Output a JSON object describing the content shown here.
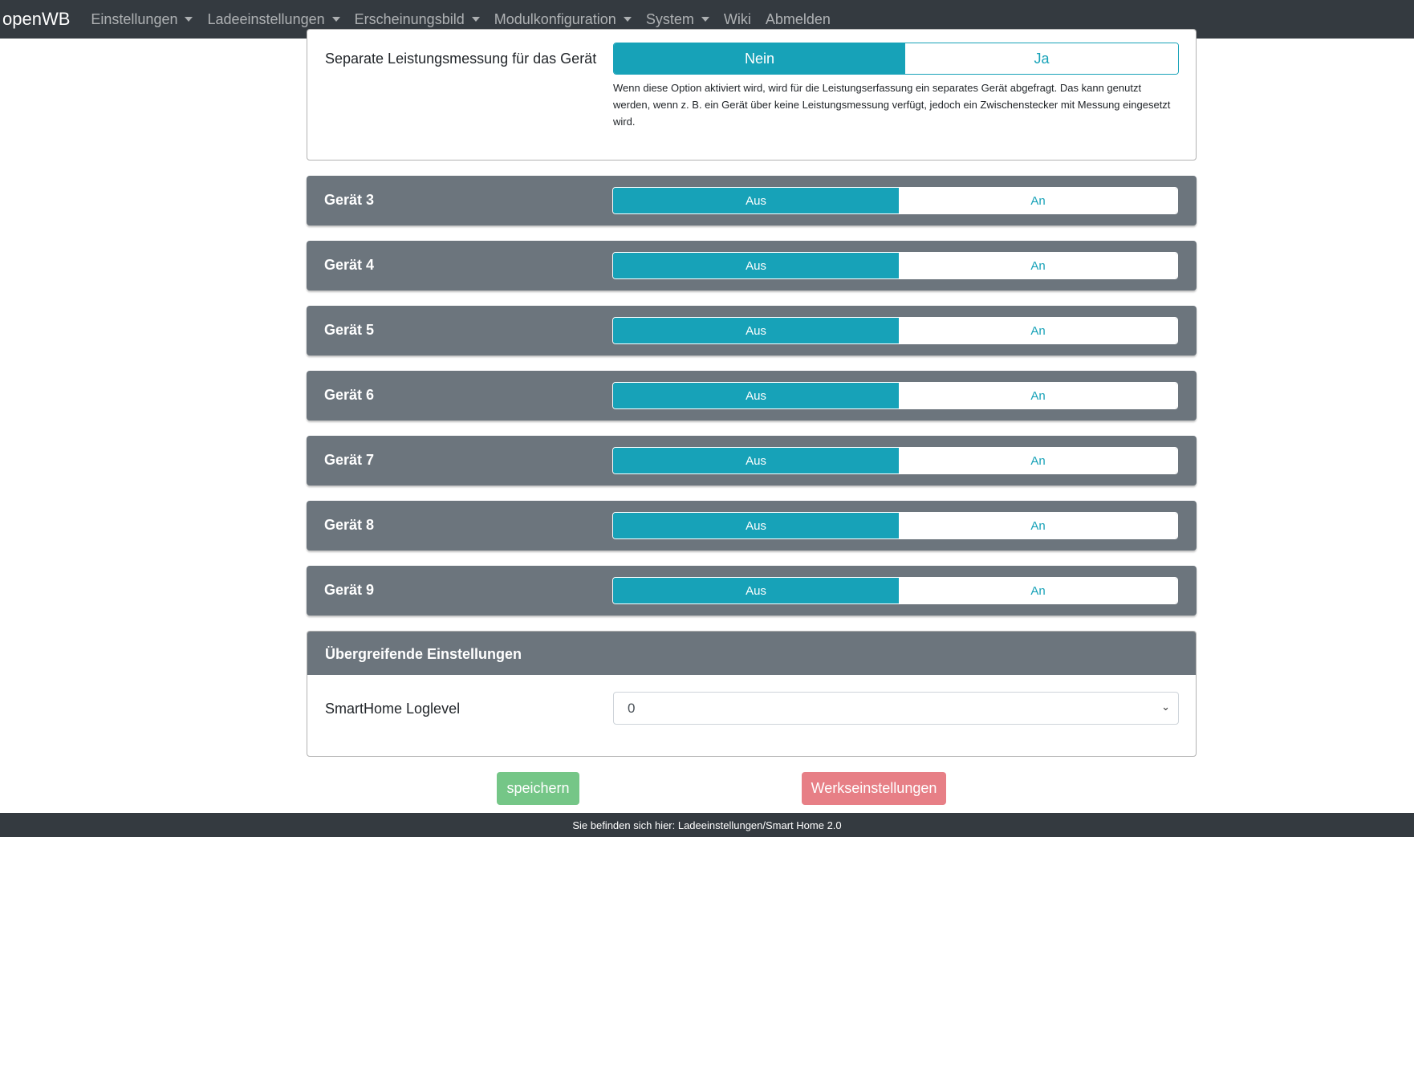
{
  "navbar": {
    "brand": "openWB",
    "items": [
      {
        "label": "Einstellungen",
        "dropdown": true
      },
      {
        "label": "Ladeeinstellungen",
        "dropdown": true
      },
      {
        "label": "Erscheinungsbild",
        "dropdown": true
      },
      {
        "label": "Modulkonfiguration",
        "dropdown": true
      },
      {
        "label": "System",
        "dropdown": true
      },
      {
        "label": "Wiki",
        "dropdown": false
      },
      {
        "label": "Abmelden",
        "dropdown": false
      }
    ]
  },
  "separate": {
    "label": "Separate Leistungsmessung für das Gerät",
    "options": [
      "Nein",
      "Ja"
    ],
    "selected": "Nein",
    "help": "Wenn diese Option aktiviert wird, wird für die Leistungserfassung ein separates Gerät abgefragt. Das kann genutzt werden, wenn z. B. ein Gerät über keine Leistungsmessung verfügt, jedoch ein Zwischenstecker mit Messung eingesetzt wird."
  },
  "devices": [
    {
      "name": "Gerät 3",
      "off": "Aus",
      "on": "An",
      "selected": "Aus"
    },
    {
      "name": "Gerät 4",
      "off": "Aus",
      "on": "An",
      "selected": "Aus"
    },
    {
      "name": "Gerät 5",
      "off": "Aus",
      "on": "An",
      "selected": "Aus"
    },
    {
      "name": "Gerät 6",
      "off": "Aus",
      "on": "An",
      "selected": "Aus"
    },
    {
      "name": "Gerät 7",
      "off": "Aus",
      "on": "An",
      "selected": "Aus"
    },
    {
      "name": "Gerät 8",
      "off": "Aus",
      "on": "An",
      "selected": "Aus"
    },
    {
      "name": "Gerät 9",
      "off": "Aus",
      "on": "An",
      "selected": "Aus"
    }
  ],
  "global": {
    "title": "Übergreifende Einstellungen",
    "loglevel_label": "SmartHome Loglevel",
    "loglevel_value": "0"
  },
  "buttons": {
    "save": "speichern",
    "reset": "Werkseinstellungen"
  },
  "footer": "Sie befinden sich hier: Ladeeinstellungen/Smart Home 2.0",
  "colors": {
    "accent": "#17a2b8",
    "navbar": "#343a40",
    "card_header": "#6c757d",
    "save": "#75c687",
    "reset": "#e77f86"
  }
}
